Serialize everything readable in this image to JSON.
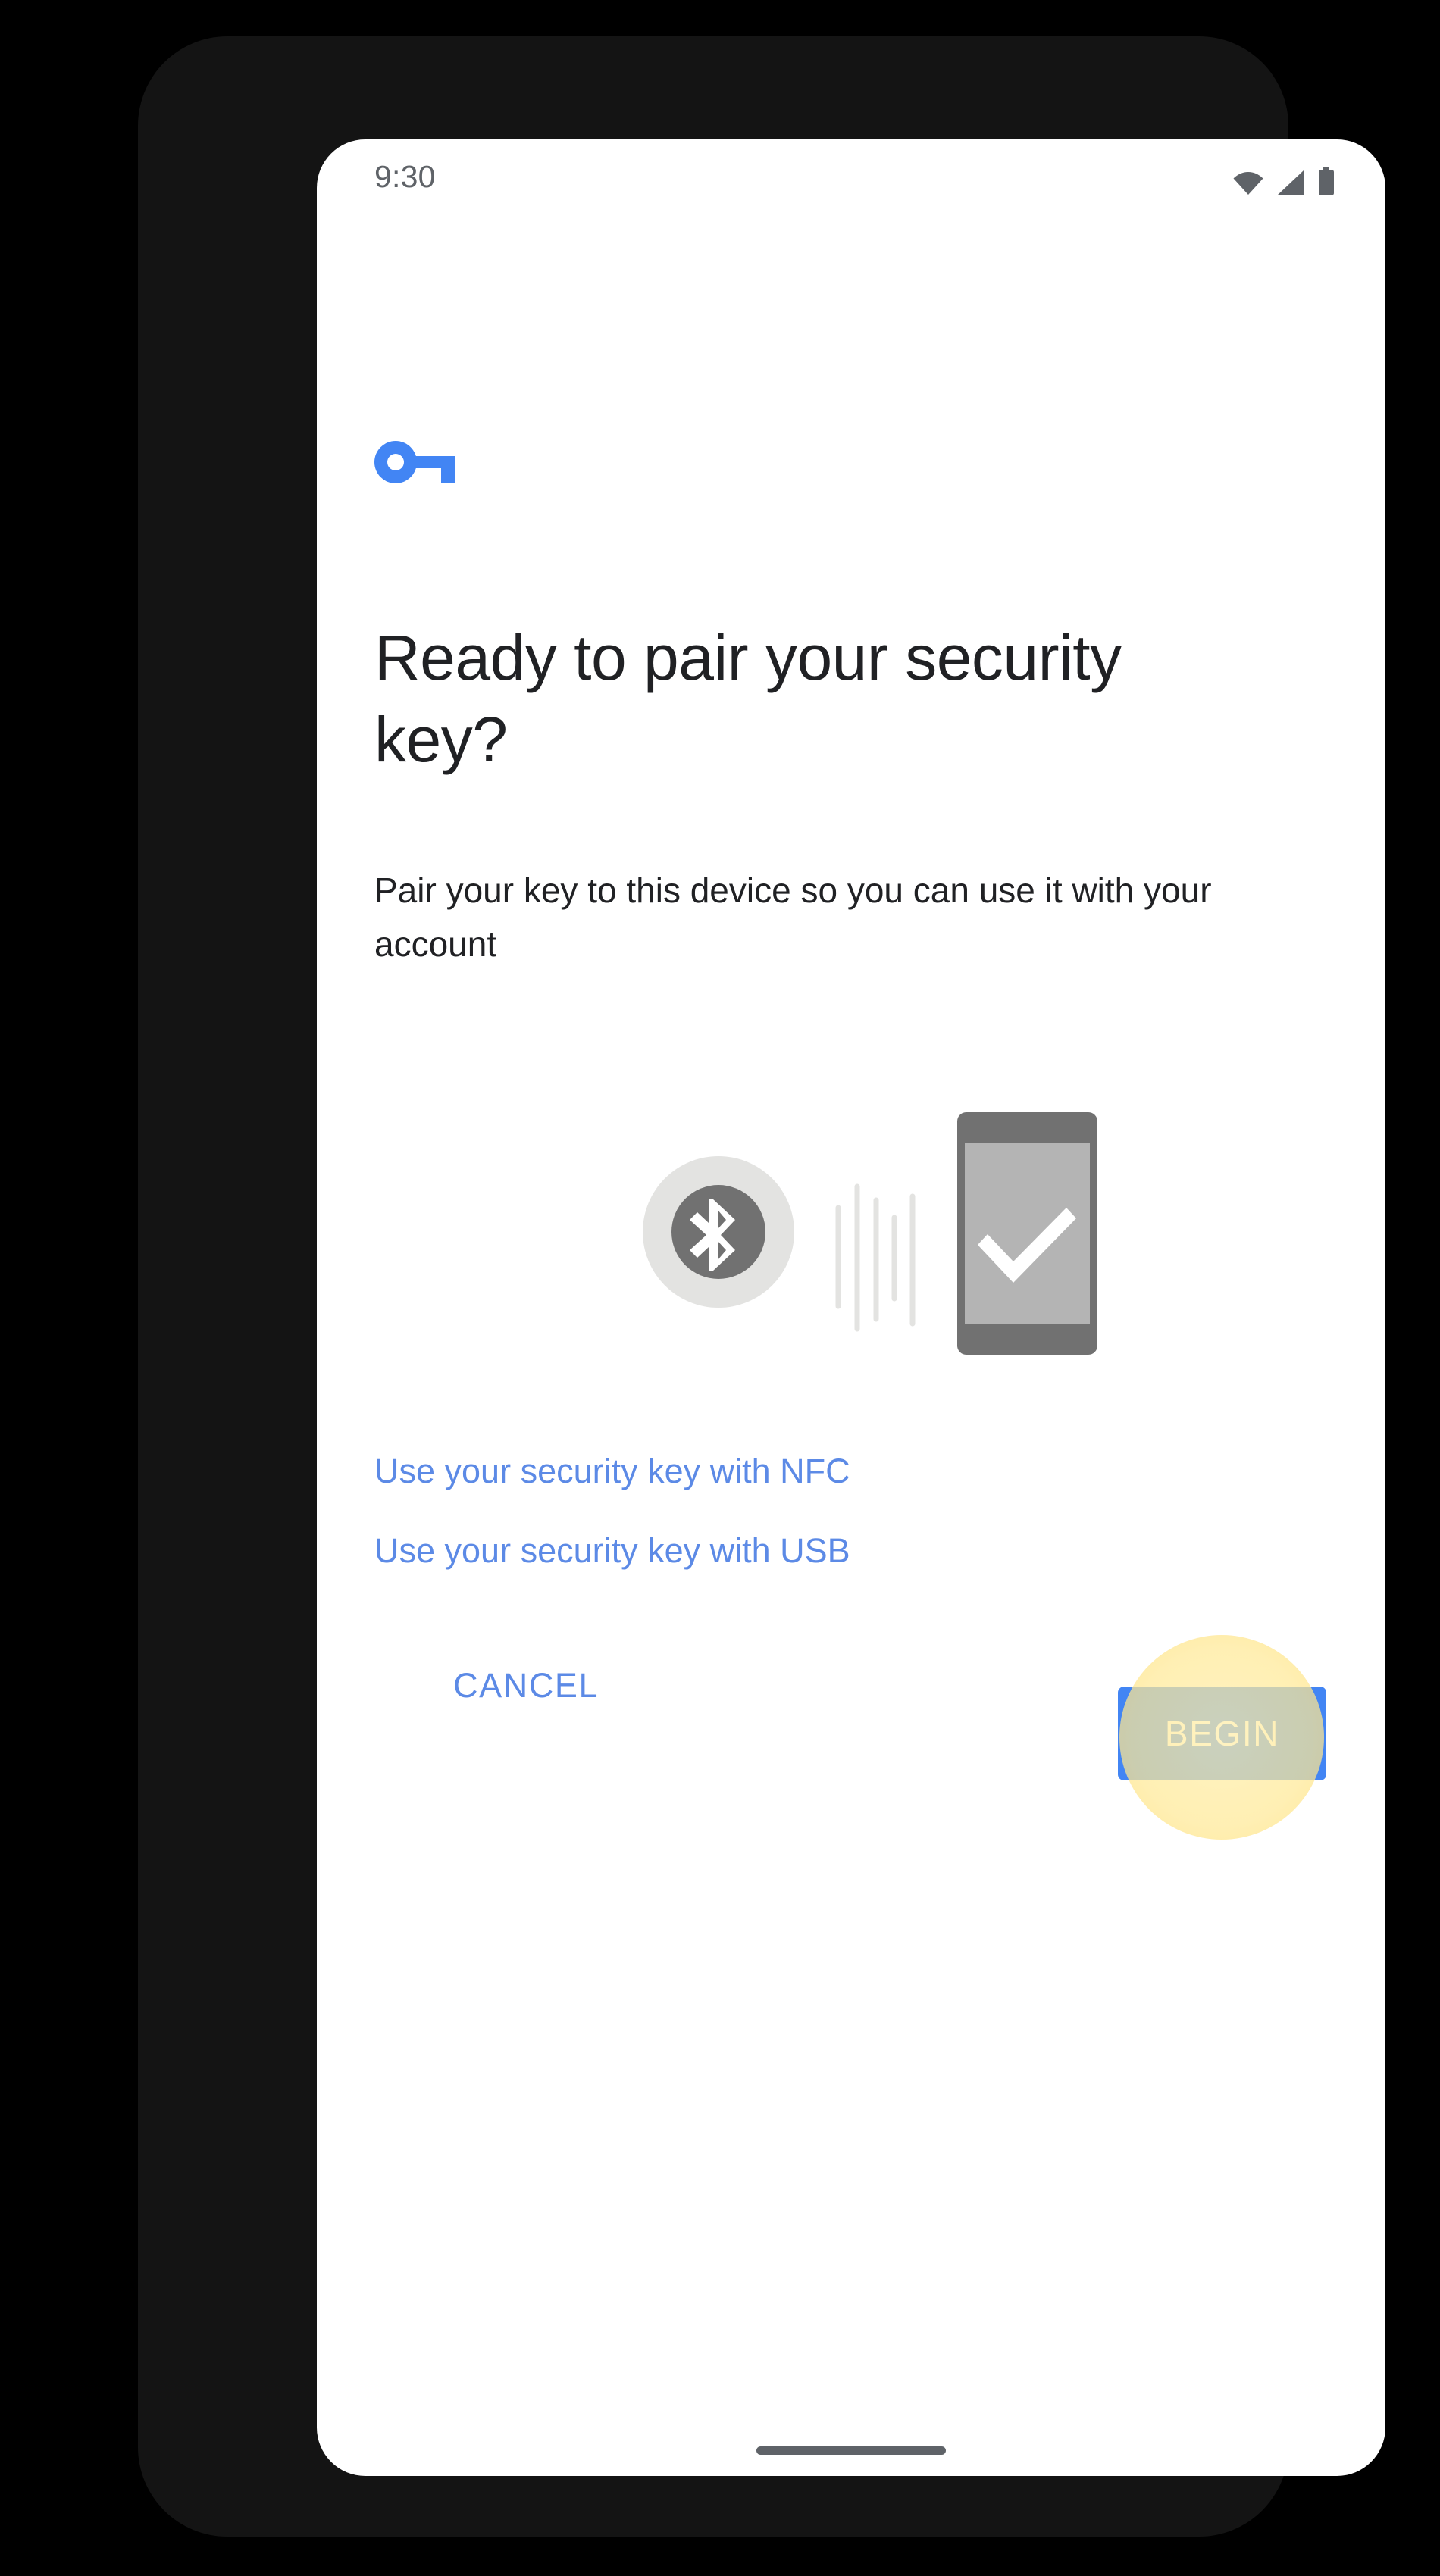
{
  "status_bar": {
    "time": "9:30",
    "icons": [
      {
        "name": "wifi-icon",
        "label": "Wi-Fi"
      },
      {
        "name": "cellular-signal-icon",
        "label": "Cellular signal"
      },
      {
        "name": "battery-icon",
        "label": "Battery"
      }
    ],
    "icon_color": "#5f6368"
  },
  "header": {
    "logo_icon": "security-key-icon",
    "logo_color": "#4285f4",
    "title": "Ready to pair your security key?",
    "subtitle": "Pair your key to this device so you can use it with your account"
  },
  "illustration": {
    "name": "bluetooth-pairing-illustration",
    "bluetooth_outer_circle_color": "#e3e3e1",
    "bluetooth_inner_circle_color": "#717171",
    "bluetooth_glyph_color": "#ffffff",
    "wave_color": "#e3e3e1",
    "wave_count": 5,
    "phone_body_color": "#717171",
    "phone_screen_color": "#b4b4b4",
    "checkmark_color": "#ffffff"
  },
  "links": [
    {
      "name": "nfc-link",
      "label": "Use your security key with NFC"
    },
    {
      "name": "usb-link",
      "label": "Use your security key with USB"
    }
  ],
  "actions": {
    "cancel_label": "CANCEL",
    "begin_label": "BEGIN",
    "begin_button_color": "#4285f4",
    "link_color": "#5c8ae6",
    "tap_highlight_color": "#fac428"
  },
  "system_nav": {
    "home_indicator": "home-indicator-bar"
  }
}
